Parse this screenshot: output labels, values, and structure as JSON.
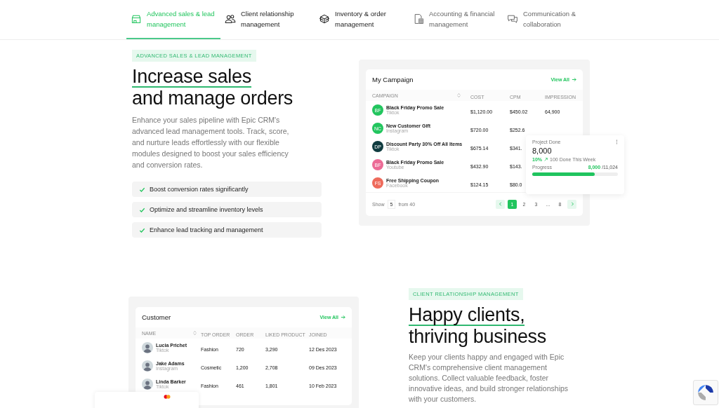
{
  "tabs": [
    {
      "label": "Advanced sales & lead management",
      "selected": true
    },
    {
      "label": "Client relationship management",
      "selected": false
    },
    {
      "label": "Inventory & order management",
      "selected": false
    },
    {
      "label": "Accounting & financial management",
      "selected": false
    },
    {
      "label": "Communication & collaboration",
      "selected": false
    }
  ],
  "sales": {
    "tag": "ADVANCED SALES & LEAD MANAGEMENT",
    "heading_underlined": "Increase sales",
    "heading_rest": "and manage orders",
    "body": "Enhance your sales pipeline with Epic CRM's advanced lead management tools. Track, score, and nurture leads effortlessly with our flexible modules designed to boost your sales efficiency and conversion rates.",
    "benefits": [
      "Boost conversion rates significantly",
      "Optimize and streamline inventory levels",
      "Enhance lead tracking and management"
    ],
    "campaign": {
      "title": "My Campaign",
      "view_all": "View All",
      "columns": [
        "CAMPAIGN",
        "COST",
        "CPM",
        "IMPRESSION"
      ],
      "rows": [
        {
          "initials": "BF",
          "color": "#22c55e",
          "name": "Black Friday Promo Sale",
          "source": "Tiktok",
          "cost": "$1,120.00",
          "cpm": "$450.02",
          "impression": "64,900"
        },
        {
          "initials": "NC",
          "color": "#22c55e",
          "name": "New Customer Gift",
          "source": "Instagram",
          "cost": "$720.00",
          "cpm": "$252.6"
        },
        {
          "initials": "DP",
          "color": "#0f3b3f",
          "name": "Discount Party 30% Off All Items",
          "source": "Tiktok",
          "cost": "$675.14",
          "cpm": "$341."
        },
        {
          "initials": "BF",
          "color": "#ec6b96",
          "name": "Black Friday Promo Sale",
          "source": "Youtube",
          "cost": "$432.90",
          "cpm": "$143."
        },
        {
          "initials": "FS",
          "color": "#ee6a5b",
          "name": "Free Shipping Coupon",
          "source": "Facebook",
          "cost": "$124.15",
          "cpm": "$80.0"
        }
      ],
      "show_label": "Show",
      "page_size": "5",
      "from_label": "from 40",
      "pages": [
        {
          "label": "1",
          "selected": true
        },
        {
          "label": "2",
          "selected": false
        },
        {
          "label": "3",
          "selected": false
        },
        {
          "label": "...",
          "selected": false
        },
        {
          "label": "8",
          "selected": false
        }
      ]
    },
    "project": {
      "title": "Project Done",
      "value": "8,000",
      "change": "10%",
      "week": "100 Done This Week",
      "progress_label": "Progress",
      "progress_value": "8,000",
      "progress_total": "/11,024",
      "level": 0.73
    }
  },
  "clients": {
    "tag": "CLIENT RELATIONSHIP MANAGEMENT",
    "heading_underlined": "Happy clients,",
    "heading_rest": "thriving business",
    "body": "Keep your clients happy and engaged with Epic CRM's comprehensive client management solutions. Collect valuable feedback, foster innovative ideas, and build stronger relationships with your customers.",
    "customer": {
      "title": "Customer",
      "view_all": "View All",
      "columns": [
        "NAME",
        "TOP ORDER",
        "ORDER",
        "LIKED PRODUCT",
        "JOINED"
      ],
      "rows": [
        {
          "name": "Lucia Prichet",
          "source": "Tiktok",
          "top_order": "Fashion",
          "order": "720",
          "liked": "3,290",
          "joined": "12 Des 2023"
        },
        {
          "name": "Jake Adams",
          "source": "Instagram",
          "top_order": "Cosmetic",
          "order": "1,200",
          "liked": "2,708",
          "joined": "09 Des 2023"
        },
        {
          "name": "Linda Barker",
          "source": "Tiktok",
          "top_order": "Fashion",
          "order": "461",
          "liked": "1,801",
          "joined": "10 Feb 2023"
        }
      ]
    }
  }
}
